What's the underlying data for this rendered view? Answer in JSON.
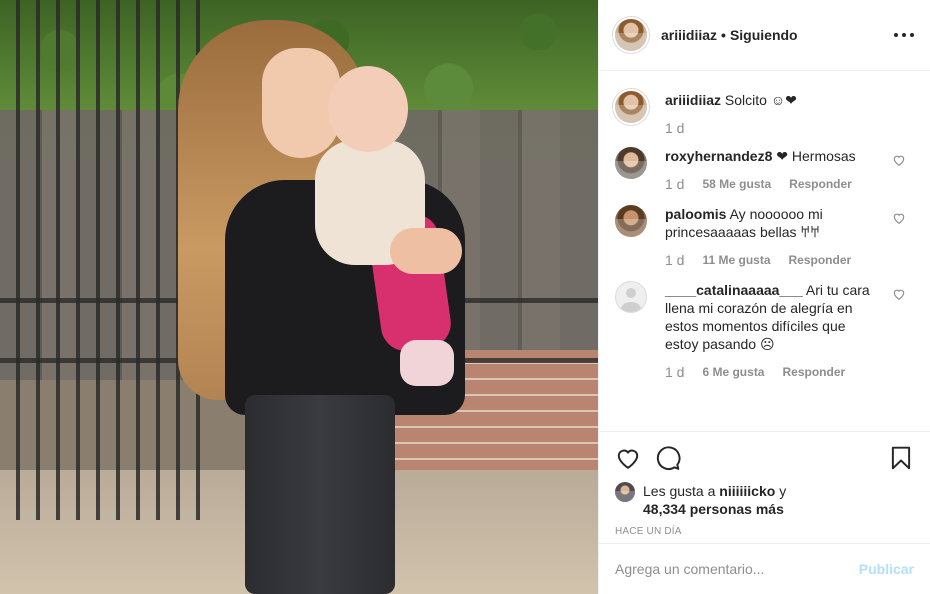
{
  "post": {
    "owner": "ariiidiiaz",
    "separator": "•",
    "follow_state": "Siguiendo"
  },
  "caption": {
    "username": "ariiidiiaz",
    "text": "Solcito ☺︎❤︎",
    "time": "1 d"
  },
  "comments": [
    {
      "username": "roxyhernandez8",
      "text": "❤︎ Hermosas",
      "time": "1 d",
      "likes": "58 Me gusta",
      "reply": "Responder"
    },
    {
      "username": "paloomis",
      "text": "Ay noooooo mi princesaaaaas bellas 𐀀𐀀",
      "time": "1 d",
      "likes": "11 Me gusta",
      "reply": "Responder"
    },
    {
      "username": "____catalinaaaaa___",
      "text": "Ari tu cara llena mi corazón de alegría en estos momentos difíciles que estoy pasando ☹︎",
      "time": "1 d",
      "likes": "6 Me gusta",
      "reply": "Responder"
    }
  ],
  "likes": {
    "prefix": "Les gusta a",
    "user": "niiiiiicko",
    "conj": "y",
    "count": "48,334 personas más"
  },
  "time_ago": "HACE UN DÍA",
  "add_comment": {
    "placeholder": "Agrega un comentario...",
    "publish": "Publicar"
  },
  "icons": {
    "like": "heart-icon",
    "comment": "comment-icon",
    "save": "bookmark-icon",
    "more": "more-options-icon"
  },
  "colors": {
    "text": "#262626",
    "muted": "#8e8e8e",
    "border": "#efefef",
    "publish_disabled": "#b2dffc"
  }
}
